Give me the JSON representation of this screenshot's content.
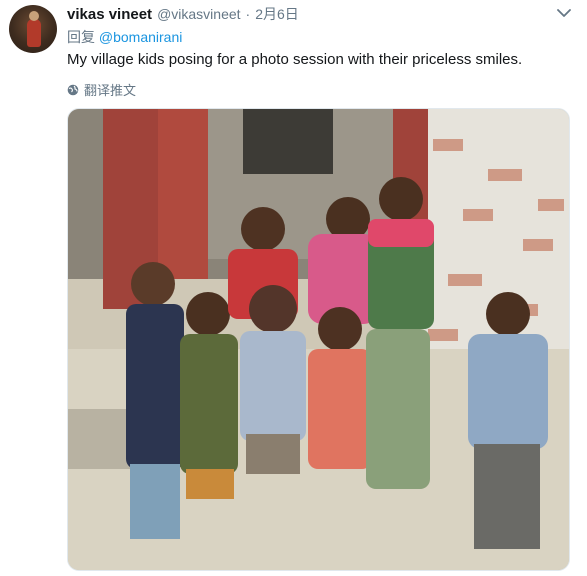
{
  "tweet": {
    "display_name": "vikas vineet",
    "handle": "@vikasvineet",
    "separator": "·",
    "date": "2月6日",
    "reply_prefix": "回复",
    "reply_to": "@bomanirani",
    "text": "My village kids posing for a photo session with their priceless smiles.",
    "translate_label": "翻译推文",
    "icons": {
      "menu": "chevron-down-icon",
      "translate": "globe-icon"
    },
    "colors": {
      "text": "#14171a",
      "secondary": "#657786",
      "link": "#1b95e0"
    }
  }
}
